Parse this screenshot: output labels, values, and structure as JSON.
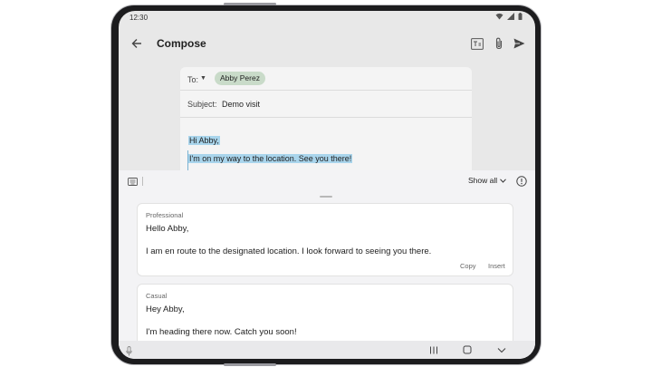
{
  "status_bar": {
    "time": "12:30"
  },
  "app_bar": {
    "title": "Compose"
  },
  "compose": {
    "to_label": "To:",
    "recipient": "Abby Perez",
    "subject_label": "Subject:",
    "subject_value": "Demo visit",
    "body_line_1": "Hi Abby,",
    "body_line_2": "I'm on my way to the location. See you there!"
  },
  "panel": {
    "show_all_label": "Show all",
    "suggestions": [
      {
        "style": "Professional",
        "greeting": "Hello Abby,",
        "text": "I am en route to the designated location. I look forward to seeing you there.",
        "copy_label": "Copy",
        "insert_label": "Insert"
      },
      {
        "style": "Casual",
        "greeting": "Hey Abby,",
        "text": "I'm heading there now. Catch you soon!"
      }
    ]
  },
  "colors": {
    "selection": "#a9d5ec",
    "chip": "#c9dbc9",
    "screen_bg": "#e8e8e8",
    "panel_bg": "#f3f3f5"
  }
}
